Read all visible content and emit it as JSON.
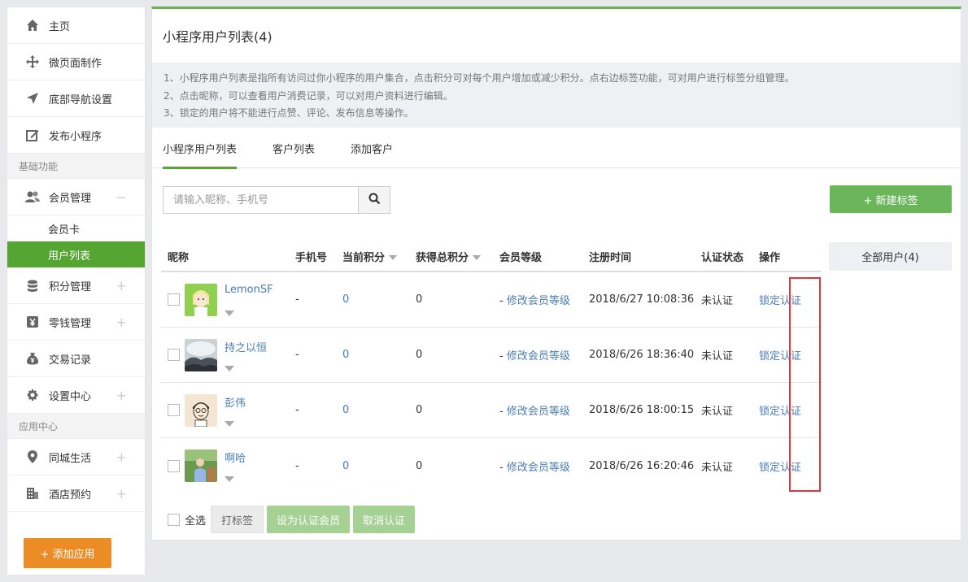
{
  "sidebar": {
    "items_top": [
      {
        "label": "主页",
        "icon": "home-icon"
      },
      {
        "label": "微页面制作",
        "icon": "move-icon"
      },
      {
        "label": "底部导航设置",
        "icon": "navigation-icon"
      },
      {
        "label": "发布小程序",
        "icon": "edit-icon"
      }
    ],
    "section_basic": "基础功能",
    "member_manage": {
      "label": "会员管理",
      "toggle": "−"
    },
    "sub_items": [
      {
        "label": "会员卡"
      },
      {
        "label": "用户列表"
      }
    ],
    "items_basic": [
      {
        "label": "积分管理",
        "toggle": "+"
      },
      {
        "label": "零钱管理",
        "toggle": "+"
      },
      {
        "label": "交易记录"
      },
      {
        "label": "设置中心",
        "toggle": "+"
      }
    ],
    "section_apps": "应用中心",
    "items_apps": [
      {
        "label": "同城生活",
        "toggle": "+"
      },
      {
        "label": "酒店预约",
        "toggle": "+"
      }
    ],
    "add_app": "+ 添加应用"
  },
  "main": {
    "title": "小程序用户列表(4)",
    "notice": [
      "1、小程序用户列表是指所有访问过你小程序的用户集合，点击积分可对每个用户增加或减少积分。点右边标签功能，可对用户进行标签分组管理。",
      "2、点击昵称，可以查看用户消费记录，可以对用户资料进行编辑。",
      "3、锁定的用户将不能进行点赞、评论、发布信息等操作。"
    ],
    "tabs": [
      "小程序用户列表",
      "客户列表",
      "添加客户"
    ],
    "search_placeholder": "请输入昵称、手机号",
    "new_tag": "+ 新建标签",
    "side_filter": "全部用户(4)",
    "columns": {
      "nickname": "昵称",
      "phone": "手机号",
      "points": "当前积分",
      "total_points": "获得总积分",
      "level": "会员等级",
      "reg_time": "注册时间",
      "auth_status": "认证状态",
      "ops": "操作"
    },
    "rows": [
      {
        "nickname": "LemonSF",
        "phone": "-",
        "points": "0",
        "total_points": "0",
        "level_prefix": "- ",
        "level_link": "修改会员等级",
        "reg_time": "2018/6/27 10:08:36",
        "auth": "未认证",
        "lock": "锁定",
        "verify": "认证"
      },
      {
        "nickname": "持之以恒",
        "phone": "-",
        "points": "0",
        "total_points": "0",
        "level_prefix": "- ",
        "level_link": "修改会员等级",
        "reg_time": "2018/6/26 18:36:40",
        "auth": "未认证",
        "lock": "锁定",
        "verify": "认证"
      },
      {
        "nickname": "彭伟",
        "phone": "-",
        "points": "0",
        "total_points": "0",
        "level_prefix": "- ",
        "level_link": "修改会员等级",
        "reg_time": "2018/6/26 18:00:15",
        "auth": "未认证",
        "lock": "锁定",
        "verify": "认证"
      },
      {
        "nickname": "啊哈",
        "phone": "-",
        "points": "0",
        "total_points": "0",
        "level_prefix": "- ",
        "level_link": "修改会员等级",
        "reg_time": "2018/6/26 16:20:46",
        "auth": "未认证",
        "lock": "锁定",
        "verify": "认证"
      }
    ],
    "bottom": {
      "select_all": "全选",
      "tag_btn": "打标签",
      "set_auth_btn": "设为认证会员",
      "cancel_auth_btn": "取消认证"
    }
  },
  "colors": {
    "accent_green": "#55a532",
    "orange": "#ec8c24",
    "link_blue": "#4a7cb4",
    "highlight_red": "#e2373a"
  }
}
